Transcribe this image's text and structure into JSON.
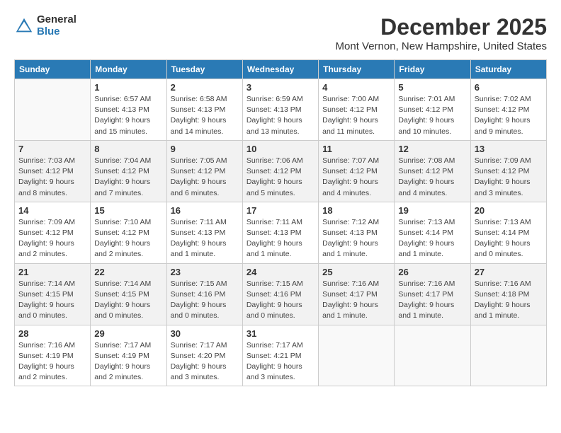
{
  "logo": {
    "general": "General",
    "blue": "Blue"
  },
  "title": "December 2025",
  "location": "Mont Vernon, New Hampshire, United States",
  "headers": [
    "Sunday",
    "Monday",
    "Tuesday",
    "Wednesday",
    "Thursday",
    "Friday",
    "Saturday"
  ],
  "weeks": [
    [
      {
        "day": "",
        "info": ""
      },
      {
        "day": "1",
        "info": "Sunrise: 6:57 AM\nSunset: 4:13 PM\nDaylight: 9 hours\nand 15 minutes."
      },
      {
        "day": "2",
        "info": "Sunrise: 6:58 AM\nSunset: 4:13 PM\nDaylight: 9 hours\nand 14 minutes."
      },
      {
        "day": "3",
        "info": "Sunrise: 6:59 AM\nSunset: 4:13 PM\nDaylight: 9 hours\nand 13 minutes."
      },
      {
        "day": "4",
        "info": "Sunrise: 7:00 AM\nSunset: 4:12 PM\nDaylight: 9 hours\nand 11 minutes."
      },
      {
        "day": "5",
        "info": "Sunrise: 7:01 AM\nSunset: 4:12 PM\nDaylight: 9 hours\nand 10 minutes."
      },
      {
        "day": "6",
        "info": "Sunrise: 7:02 AM\nSunset: 4:12 PM\nDaylight: 9 hours\nand 9 minutes."
      }
    ],
    [
      {
        "day": "7",
        "info": "Sunrise: 7:03 AM\nSunset: 4:12 PM\nDaylight: 9 hours\nand 8 minutes."
      },
      {
        "day": "8",
        "info": "Sunrise: 7:04 AM\nSunset: 4:12 PM\nDaylight: 9 hours\nand 7 minutes."
      },
      {
        "day": "9",
        "info": "Sunrise: 7:05 AM\nSunset: 4:12 PM\nDaylight: 9 hours\nand 6 minutes."
      },
      {
        "day": "10",
        "info": "Sunrise: 7:06 AM\nSunset: 4:12 PM\nDaylight: 9 hours\nand 5 minutes."
      },
      {
        "day": "11",
        "info": "Sunrise: 7:07 AM\nSunset: 4:12 PM\nDaylight: 9 hours\nand 4 minutes."
      },
      {
        "day": "12",
        "info": "Sunrise: 7:08 AM\nSunset: 4:12 PM\nDaylight: 9 hours\nand 4 minutes."
      },
      {
        "day": "13",
        "info": "Sunrise: 7:09 AM\nSunset: 4:12 PM\nDaylight: 9 hours\nand 3 minutes."
      }
    ],
    [
      {
        "day": "14",
        "info": "Sunrise: 7:09 AM\nSunset: 4:12 PM\nDaylight: 9 hours\nand 2 minutes."
      },
      {
        "day": "15",
        "info": "Sunrise: 7:10 AM\nSunset: 4:12 PM\nDaylight: 9 hours\nand 2 minutes."
      },
      {
        "day": "16",
        "info": "Sunrise: 7:11 AM\nSunset: 4:13 PM\nDaylight: 9 hours\nand 1 minute."
      },
      {
        "day": "17",
        "info": "Sunrise: 7:11 AM\nSunset: 4:13 PM\nDaylight: 9 hours\nand 1 minute."
      },
      {
        "day": "18",
        "info": "Sunrise: 7:12 AM\nSunset: 4:13 PM\nDaylight: 9 hours\nand 1 minute."
      },
      {
        "day": "19",
        "info": "Sunrise: 7:13 AM\nSunset: 4:14 PM\nDaylight: 9 hours\nand 1 minute."
      },
      {
        "day": "20",
        "info": "Sunrise: 7:13 AM\nSunset: 4:14 PM\nDaylight: 9 hours\nand 0 minutes."
      }
    ],
    [
      {
        "day": "21",
        "info": "Sunrise: 7:14 AM\nSunset: 4:15 PM\nDaylight: 9 hours\nand 0 minutes."
      },
      {
        "day": "22",
        "info": "Sunrise: 7:14 AM\nSunset: 4:15 PM\nDaylight: 9 hours\nand 0 minutes."
      },
      {
        "day": "23",
        "info": "Sunrise: 7:15 AM\nSunset: 4:16 PM\nDaylight: 9 hours\nand 0 minutes."
      },
      {
        "day": "24",
        "info": "Sunrise: 7:15 AM\nSunset: 4:16 PM\nDaylight: 9 hours\nand 0 minutes."
      },
      {
        "day": "25",
        "info": "Sunrise: 7:16 AM\nSunset: 4:17 PM\nDaylight: 9 hours\nand 1 minute."
      },
      {
        "day": "26",
        "info": "Sunrise: 7:16 AM\nSunset: 4:17 PM\nDaylight: 9 hours\nand 1 minute."
      },
      {
        "day": "27",
        "info": "Sunrise: 7:16 AM\nSunset: 4:18 PM\nDaylight: 9 hours\nand 1 minute."
      }
    ],
    [
      {
        "day": "28",
        "info": "Sunrise: 7:16 AM\nSunset: 4:19 PM\nDaylight: 9 hours\nand 2 minutes."
      },
      {
        "day": "29",
        "info": "Sunrise: 7:17 AM\nSunset: 4:19 PM\nDaylight: 9 hours\nand 2 minutes."
      },
      {
        "day": "30",
        "info": "Sunrise: 7:17 AM\nSunset: 4:20 PM\nDaylight: 9 hours\nand 3 minutes."
      },
      {
        "day": "31",
        "info": "Sunrise: 7:17 AM\nSunset: 4:21 PM\nDaylight: 9 hours\nand 3 minutes."
      },
      {
        "day": "",
        "info": ""
      },
      {
        "day": "",
        "info": ""
      },
      {
        "day": "",
        "info": ""
      }
    ]
  ]
}
